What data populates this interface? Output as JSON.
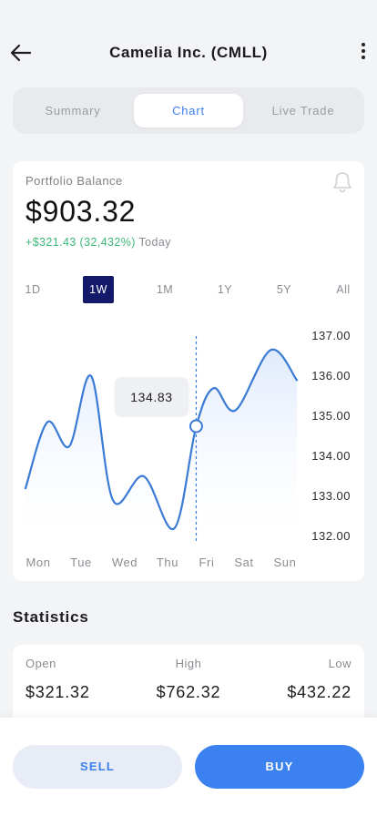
{
  "header": {
    "title": "Camelia Inc. (CMLL)"
  },
  "tabs": [
    {
      "label": "Summary"
    },
    {
      "label": "Chart"
    },
    {
      "label": "Live Trade"
    }
  ],
  "portfolio": {
    "label": "Portfolio Balance",
    "balance": "$903.32",
    "change": "+$321.43 (32,432%)",
    "change_period": "Today"
  },
  "periods": [
    "1D",
    "1W",
    "1M",
    "1Y",
    "5Y",
    "All"
  ],
  "active_period": "1W",
  "chart_data": {
    "type": "line",
    "categories": [
      "Mon",
      "Tue",
      "Wed",
      "Thu",
      "Fri",
      "Sat",
      "Sun"
    ],
    "y_ticks": [
      "137.00",
      "136.00",
      "135.00",
      "134.00",
      "133.00",
      "132.00"
    ],
    "ylim": [
      132.0,
      137.0
    ],
    "series": [
      {
        "points": [
          [
            0.0,
            133.2
          ],
          [
            0.5,
            134.85
          ],
          [
            1.0,
            134.25
          ],
          [
            1.5,
            136.0
          ],
          [
            2.0,
            132.9
          ],
          [
            2.7,
            133.5
          ],
          [
            3.4,
            132.2
          ],
          [
            3.9,
            134.75
          ],
          [
            4.3,
            135.7
          ],
          [
            4.8,
            135.15
          ],
          [
            5.6,
            136.65
          ],
          [
            6.2,
            135.9
          ]
        ]
      }
    ],
    "tooltip": {
      "label": "134.83",
      "x": 3.9,
      "y": 134.75
    },
    "colors": {
      "line": "#3a7bd5",
      "area_top": "#dce8fb",
      "area_bottom": "#ffffff"
    }
  },
  "statistics": {
    "title": "Statistics",
    "items": [
      {
        "label": "Open",
        "value": "$321.32"
      },
      {
        "label": "High",
        "value": "$762.32"
      },
      {
        "label": "Low",
        "value": "$432.22"
      }
    ]
  },
  "actions": {
    "sell_label": "SELL",
    "buy_label": "BUY"
  },
  "icons": {
    "back": "arrow-left-icon",
    "more": "more-vertical-icon",
    "bell": "bell-icon"
  }
}
